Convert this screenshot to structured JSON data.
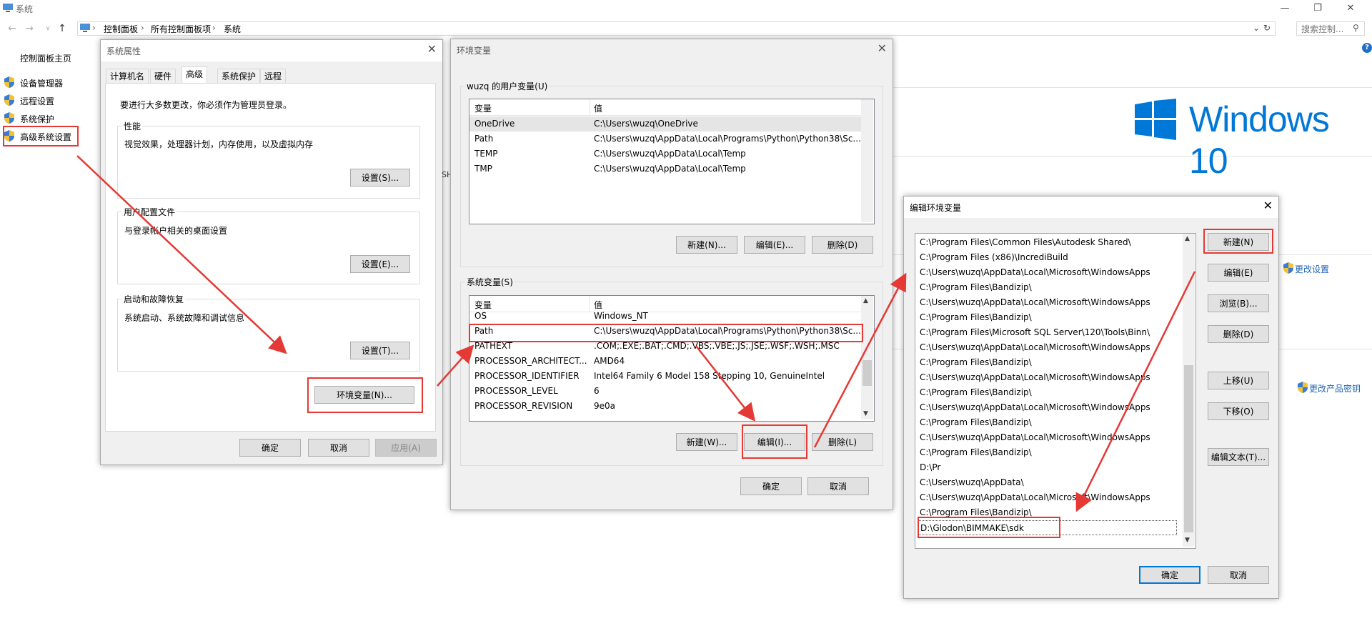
{
  "window": {
    "title": "系统",
    "minimize": "—",
    "restore": "❐",
    "close": "✕"
  },
  "address": {
    "crumbs": [
      "控制面板",
      "所有控制面板项",
      "系统"
    ],
    "search_placeholder": "搜索控制..."
  },
  "leftnav": {
    "home": "控制面板主页",
    "items": [
      "设备管理器",
      "远程设置",
      "系统保护",
      "高级系统设置"
    ]
  },
  "right": {
    "logo_text": "Windows 10",
    "change_settings": "更改设置",
    "change_key": "更改产品密钥",
    "clipped_fragment": "SH"
  },
  "sysprops": {
    "title": "系统属性",
    "tabs": [
      "计算机名",
      "硬件",
      "高级",
      "系统保护",
      "远程"
    ],
    "admin_note": "要进行大多数更改，你必须作为管理员登录。",
    "perf": {
      "label": "性能",
      "desc": "视觉效果，处理器计划，内存使用，以及虚拟内存",
      "btn": "设置(S)..."
    },
    "profile": {
      "label": "用户配置文件",
      "desc": "与登录帐户相关的桌面设置",
      "btn": "设置(E)..."
    },
    "startup": {
      "label": "启动和故障恢复",
      "desc": "系统启动、系统故障和调试信息",
      "btn": "设置(T)..."
    },
    "env_btn": "环境变量(N)...",
    "ok": "确定",
    "cancel": "取消",
    "apply": "应用(A)"
  },
  "envvars": {
    "title": "环境变量",
    "user_label": "wuzq 的用户变量(U)",
    "col_var": "变量",
    "col_val": "值",
    "user_rows": [
      {
        "var": "OneDrive",
        "val": "C:\\Users\\wuzq\\OneDrive"
      },
      {
        "var": "Path",
        "val": "C:\\Users\\wuzq\\AppData\\Local\\Programs\\Python\\Python38\\Sc..."
      },
      {
        "var": "TEMP",
        "val": "C:\\Users\\wuzq\\AppData\\Local\\Temp"
      },
      {
        "var": "TMP",
        "val": "C:\\Users\\wuzq\\AppData\\Local\\Temp"
      }
    ],
    "user_new": "新建(N)...",
    "user_edit": "编辑(E)...",
    "user_delete": "删除(D)",
    "sys_label": "系统变量(S)",
    "sys_rows": [
      {
        "var": "OS",
        "val": "Windows_NT"
      },
      {
        "var": "Path",
        "val": "C:\\Users\\wuzq\\AppData\\Local\\Programs\\Python\\Python38\\Sc..."
      },
      {
        "var": "PATHEXT",
        "val": ".COM;.EXE;.BAT;.CMD;.VBS;.VBE;.JS;.JSE;.WSF;.WSH;.MSC"
      },
      {
        "var": "PROCESSOR_ARCHITECT...",
        "val": "AMD64"
      },
      {
        "var": "PROCESSOR_IDENTIFIER",
        "val": "Intel64 Family 6 Model 158 Stepping 10, GenuineIntel"
      },
      {
        "var": "PROCESSOR_LEVEL",
        "val": "6"
      },
      {
        "var": "PROCESSOR_REVISION",
        "val": "9e0a"
      }
    ],
    "sys_new": "新建(W)...",
    "sys_edit": "编辑(I)...",
    "sys_delete": "删除(L)",
    "ok": "确定",
    "cancel": "取消"
  },
  "editenv": {
    "title": "编辑环境变量",
    "paths": [
      "C:\\Program Files\\Common Files\\Autodesk Shared\\",
      "C:\\Program Files (x86)\\IncrediBuild",
      "C:\\Users\\wuzq\\AppData\\Local\\Microsoft\\WindowsApps",
      "C:\\Program Files\\Bandizip\\",
      "C:\\Users\\wuzq\\AppData\\Local\\Microsoft\\WindowsApps",
      "C:\\Program Files\\Bandizip\\",
      "C:\\Program Files\\Microsoft SQL Server\\120\\Tools\\Binn\\",
      "C:\\Users\\wuzq\\AppData\\Local\\Microsoft\\WindowsApps",
      "C:\\Program Files\\Bandizip\\",
      "C:\\Users\\wuzq\\AppData\\Local\\Microsoft\\WindowsApps",
      "C:\\Program Files\\Bandizip\\",
      "C:\\Users\\wuzq\\AppData\\Local\\Microsoft\\WindowsApps",
      "C:\\Program Files\\Bandizip\\",
      "C:\\Users\\wuzq\\AppData\\Local\\Microsoft\\WindowsApps",
      "C:\\Program Files\\Bandizip\\",
      "D:\\Pr",
      "C:\\Users\\wuzq\\AppData\\",
      "C:\\Users\\wuzq\\AppData\\Local\\Microsoft\\WindowsApps",
      "C:\\Program Files\\Bandizip\\",
      "D:\\Glodon\\BIMMAKE\\sdk"
    ],
    "btn_new": "新建(N)",
    "btn_edit": "编辑(E)",
    "btn_browse": "浏览(B)...",
    "btn_delete": "删除(D)",
    "btn_up": "上移(U)",
    "btn_down": "下移(O)",
    "btn_edittext": "编辑文本(T)...",
    "ok": "确定",
    "cancel": "取消"
  },
  "colors": {
    "annotation_red": "#e53935",
    "link_blue": "#1e64b4",
    "win_blue": "#0078d7"
  }
}
